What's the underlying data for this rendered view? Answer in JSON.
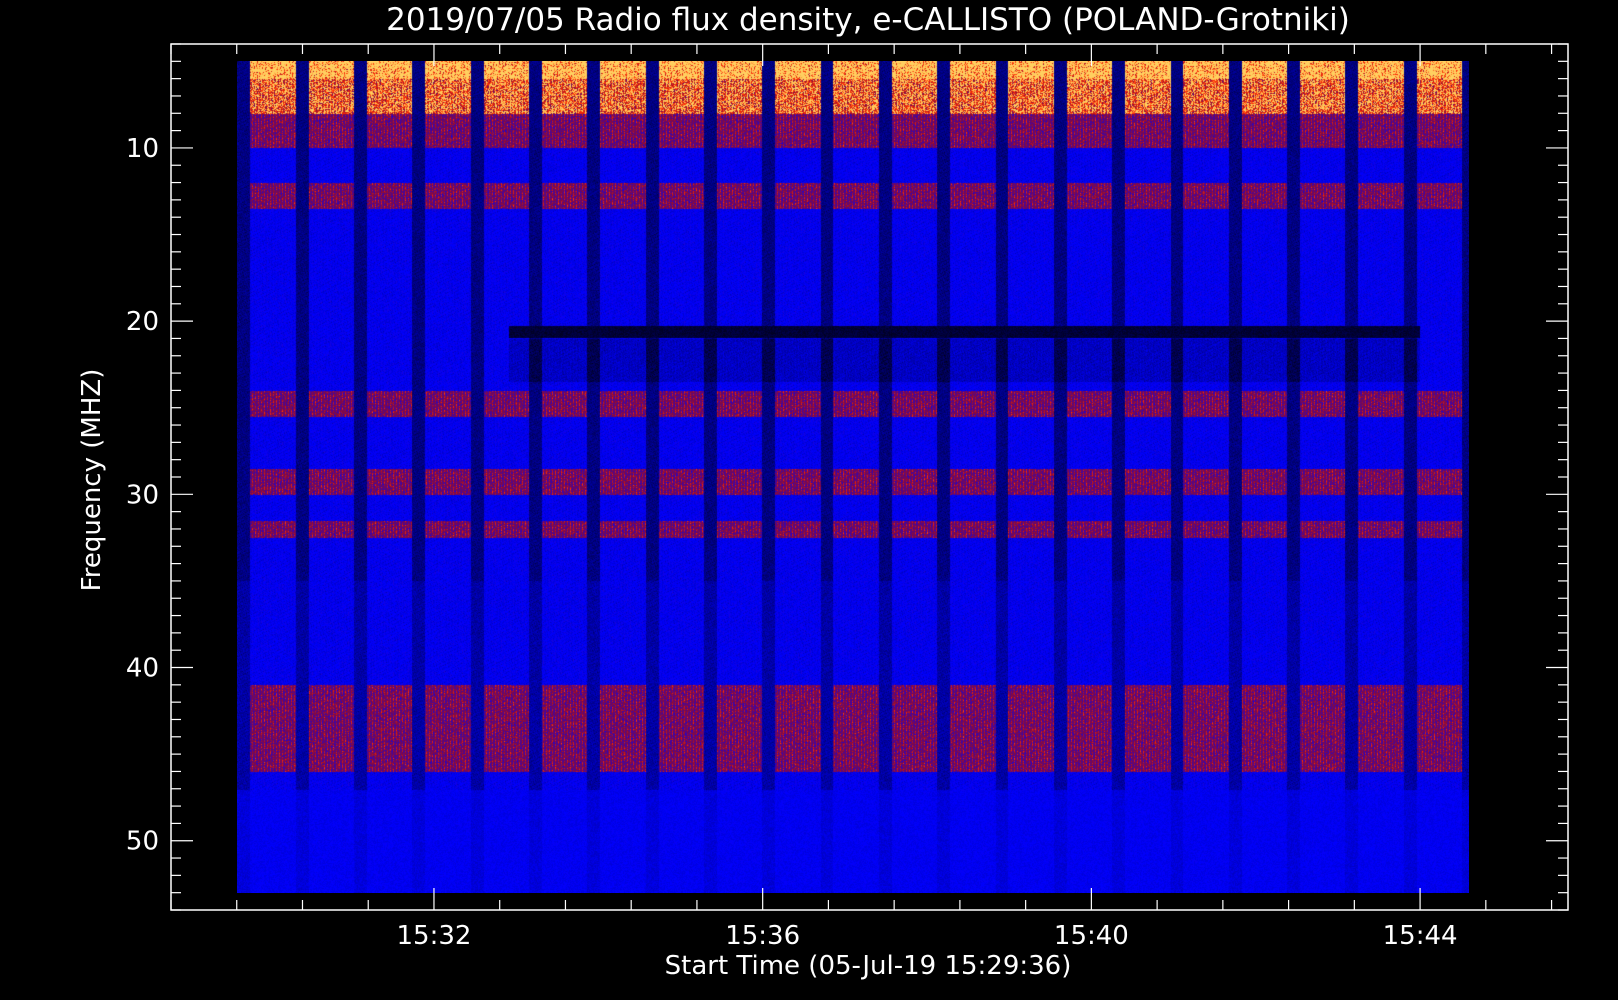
{
  "chart_data": {
    "type": "heatmap",
    "title": "2019/07/05  Radio flux density, e-CALLISTO (POLAND-Grotniki)",
    "xlabel": "Start Time (05-Jul-19 15:29:36)",
    "ylabel": "Frequency (MHZ)",
    "x_tick_labels": [
      "15:32",
      "15:36",
      "15:40",
      "15:44"
    ],
    "x_ticks_minutes": [
      2.4,
      6.4,
      10.4,
      14.4
    ],
    "xlim_minutes": [
      -0.8,
      16.2
    ],
    "data_time_range_minutes": [
      0.0,
      15.0
    ],
    "y_tick_labels": [
      "10",
      "20",
      "30",
      "40",
      "50"
    ],
    "y_ticks_mhz": [
      10,
      20,
      30,
      40,
      50
    ],
    "ylim_mhz": [
      4,
      54
    ],
    "y_inverted": true,
    "data_freq_range_mhz": [
      5,
      53
    ],
    "colormap": [
      "#000000",
      "#0000ff",
      "#8a0a3a",
      "#ff2a00",
      "#ffd060"
    ],
    "features": {
      "vertical_stripe_period_minutes": 0.71,
      "horizontal_band_mhz": 20.6,
      "horizontal_band_start_minute": 3.3,
      "horizontal_band_end_minute": 14.4,
      "strong_emission_bands_mhz": [
        [
          5,
          8
        ],
        [
          8,
          10
        ],
        [
          12,
          13.5
        ],
        [
          24,
          25.5
        ],
        [
          28.5,
          30
        ],
        [
          31.5,
          32.5
        ],
        [
          41,
          46
        ]
      ]
    }
  }
}
